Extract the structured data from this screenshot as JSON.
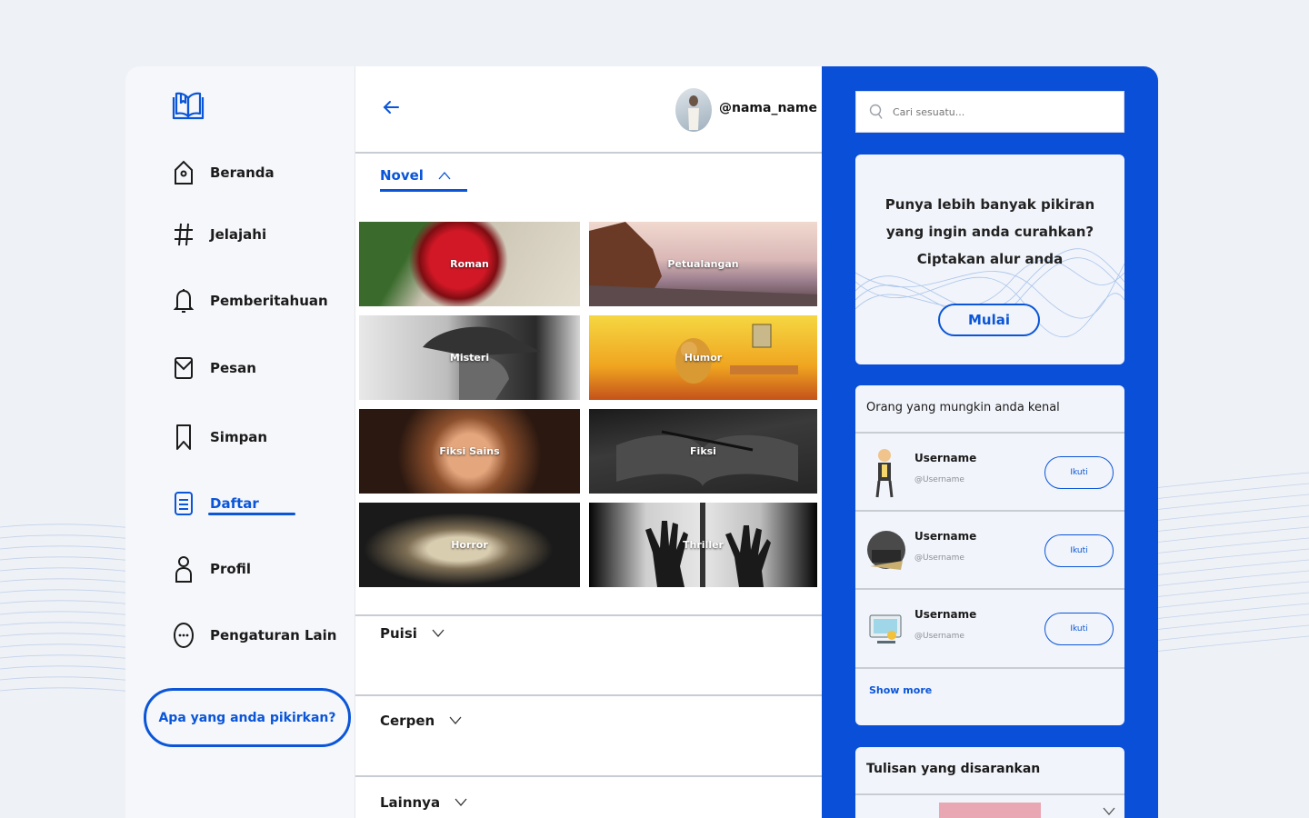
{
  "sidebar": {
    "logo_icon": "open-book-icon",
    "items": [
      {
        "label": "Beranda",
        "icon": "home-icon"
      },
      {
        "label": "Jelajahi",
        "icon": "hashtag-icon"
      },
      {
        "label": "Pemberitahuan",
        "icon": "bell-icon"
      },
      {
        "label": "Pesan",
        "icon": "mail-icon"
      },
      {
        "label": "Simpan",
        "icon": "bookmark-icon"
      },
      {
        "label": "Daftar",
        "icon": "list-document-icon",
        "active": true
      },
      {
        "label": "Profil",
        "icon": "user-icon"
      },
      {
        "label": "Pengaturan Lain",
        "icon": "more-circle-icon"
      }
    ],
    "think_button": "Apa yang anda pikirkan?"
  },
  "header": {
    "back_icon": "arrow-left-icon",
    "username": "@nama_name"
  },
  "sections": [
    {
      "title": "Novel",
      "expanded": true
    },
    {
      "title": "Puisi",
      "expanded": false
    },
    {
      "title": "Cerpen",
      "expanded": false
    },
    {
      "title": "Lainnya",
      "expanded": false
    }
  ],
  "genres": [
    {
      "label": "Roman"
    },
    {
      "label": "Petualangan"
    },
    {
      "label": "Misteri"
    },
    {
      "label": "Humor"
    },
    {
      "label": "Fiksi Sains"
    },
    {
      "label": "Fiksi"
    },
    {
      "label": "Horror"
    },
    {
      "label": "Thriller"
    }
  ],
  "right": {
    "search_placeholder": "Cari sesuatu...",
    "promo_text": "Punya lebih banyak pikiran yang ingin anda curahkan? Ciptakan alur anda",
    "promo_button": "Mulai",
    "suggest_title": "Orang yang mungkin anda kenal",
    "people": [
      {
        "name": "Username",
        "handle": "@Username",
        "follow": "Ikuti"
      },
      {
        "name": "Username",
        "handle": "@Username",
        "follow": "Ikuti"
      },
      {
        "name": "Username",
        "handle": "@Username",
        "follow": "Ikuti"
      }
    ],
    "show_more": "Show more",
    "recommend_title": "Tulisan yang disarankan"
  },
  "colors": {
    "accent": "#0a55d8",
    "panel": "#0a4fd8",
    "background": "#eef1f6"
  }
}
